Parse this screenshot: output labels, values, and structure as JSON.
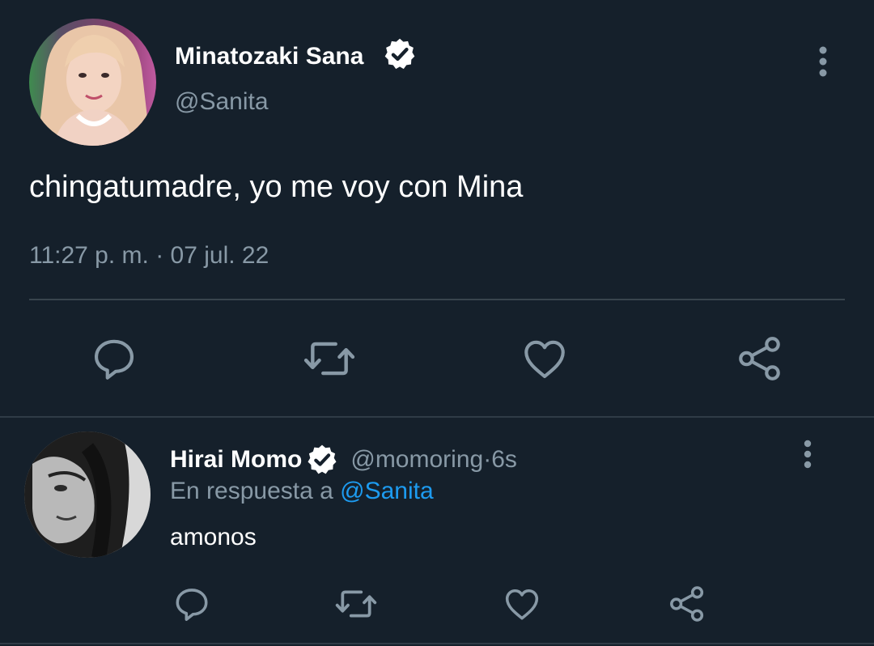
{
  "tweet": {
    "author_name": "Minatozaki Sana",
    "author_handle": "@Sanita",
    "text": "chingatumadre, yo me voy con Mina",
    "time": "11:27 p. m.",
    "separator": " · ",
    "date": "07 jul. 22"
  },
  "reply": {
    "author_name": "Hirai Momo",
    "author_handle": "@momoring",
    "separator": " · ",
    "age": "6s",
    "in_reply_prefix": "En respuesta a",
    "in_reply_handle": "@Sanita",
    "text": "amonos"
  },
  "icons": {
    "more": "more-vertical-icon",
    "verified": "verified-badge-icon",
    "reply": "reply-icon",
    "retweet": "retweet-icon",
    "like": "like-icon",
    "share": "share-icon"
  },
  "colors": {
    "background": "#15202b",
    "text": "#ffffff",
    "secondary": "#8899a6",
    "icon": "#8899a6",
    "divider": "#38444d",
    "accent": "#1d9bf0"
  }
}
